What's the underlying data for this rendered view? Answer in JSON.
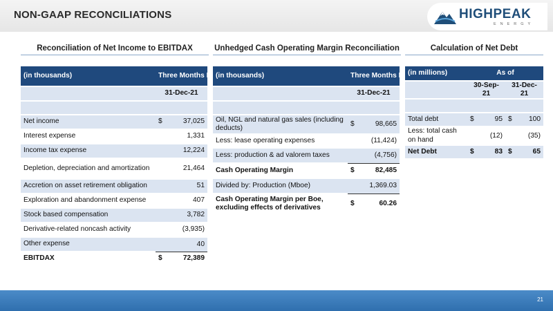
{
  "header": {
    "title": "NON-GAAP RECONCILIATIONS",
    "logo_main": "HIGHPEAK",
    "logo_sub": "ENERGY"
  },
  "ebitdax": {
    "title": "Reconciliation of Net Income to EBITDAX",
    "unit_label": "(in thousands)",
    "period_label": "Three Months Ended",
    "date_label": "31-Dec-21",
    "rows": [
      {
        "label": "Net income",
        "dollar": "$",
        "value": "37,025"
      },
      {
        "label": "Interest expense",
        "dollar": "",
        "value": "1,331"
      },
      {
        "label": "Income tax expense",
        "dollar": "",
        "value": "12,224"
      },
      {
        "label": "Depletion, depreciation and amortization",
        "dollar": "",
        "value": "21,464"
      },
      {
        "label": "Accretion on asset retirement obligation",
        "dollar": "",
        "value": "51"
      },
      {
        "label": "Exploration and abandonment expense",
        "dollar": "",
        "value": "407"
      },
      {
        "label": "Stock based compensation",
        "dollar": "",
        "value": "3,782"
      },
      {
        "label": "Derivative-related noncash activity",
        "dollar": "",
        "value": "(3,935)"
      },
      {
        "label": "Other expense",
        "dollar": "",
        "value": "40"
      },
      {
        "label": "EBITDAX",
        "dollar": "$",
        "value": "72,389"
      }
    ]
  },
  "margin": {
    "title": "Unhedged Cash Operating Margin Reconciliation",
    "unit_label": "(in thousands)",
    "period_label": "Three Months Ended",
    "date_label": "31-Dec-21",
    "rows": [
      {
        "label": "Oil, NGL and natural gas sales (including deducts)",
        "dollar": "$",
        "value": "98,665"
      },
      {
        "label": "Less: lease operating expenses",
        "dollar": "",
        "value": "(11,424)"
      },
      {
        "label": "Less: production & ad valorem taxes",
        "dollar": "",
        "value": "(4,756)"
      },
      {
        "label": "Cash Operating Margin",
        "dollar": "$",
        "value": "82,485"
      },
      {
        "label": "Divided by: Production (Mboe)",
        "dollar": "",
        "value": "1,369.03"
      },
      {
        "label": "Cash Operating Margin per Boe, excluding effects of derivatives",
        "dollar": "$",
        "value": "60.26"
      }
    ]
  },
  "netdebt": {
    "title": "Calculation of Net Debt",
    "unit_label": "(in millions)",
    "as_of_label": "As of",
    "col1_label": "30-Sep-21",
    "col2_label": "31-Dec-21",
    "rows": [
      {
        "label": "Total debt",
        "d1": "$",
        "v1": "95",
        "d2": "$",
        "v2": "100"
      },
      {
        "label": "Less: total cash on hand",
        "d1": "",
        "v1": "(12)",
        "d2": "",
        "v2": "(35)"
      },
      {
        "label": "Net Debt",
        "d1": "$",
        "v1": "83",
        "d2": "$",
        "v2": "65"
      }
    ]
  },
  "footer": {
    "page_number": "21"
  },
  "colors": {
    "header_blue": "#1f497d",
    "row_light": "#dbe4f1",
    "footer_blue": "#3a7bbf"
  }
}
